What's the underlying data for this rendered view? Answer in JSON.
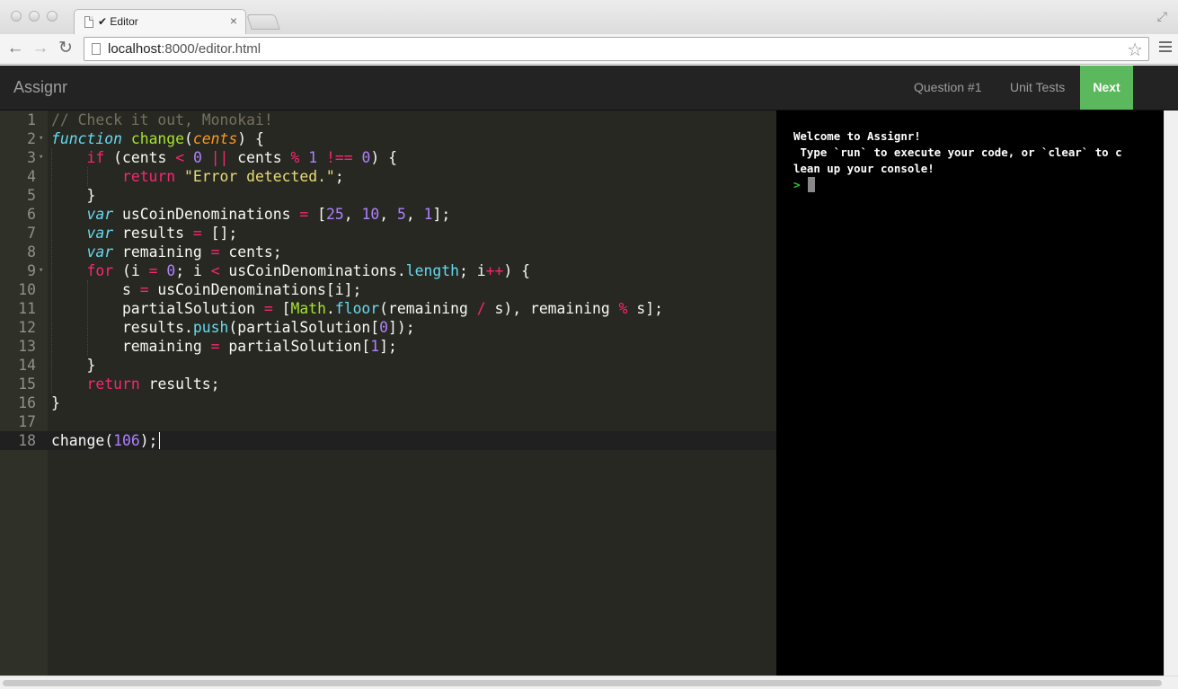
{
  "browser": {
    "tab_title": "✔ Editor",
    "tab_close": "×",
    "url_host": "localhost",
    "url_path": ":8000/editor.html",
    "back_glyph": "←",
    "forward_glyph": "→",
    "reload_glyph": "↻",
    "star_glyph": "☆",
    "fullscreen_glyph": "⤢"
  },
  "app": {
    "brand": "Assignr",
    "nav": {
      "question": "Question #1",
      "unit_tests": "Unit Tests",
      "next": "Next"
    },
    "colors": {
      "nav_bg": "#232323",
      "next_bg": "#5cb85c",
      "editor_bg": "#272822",
      "console_bg": "#000000"
    }
  },
  "editor": {
    "theme": "Monokai",
    "active_line": 18,
    "lines": [
      {
        "n": "1",
        "fold": false,
        "tokens": [
          {
            "t": "// Check it out, Monokai!",
            "c": "c-com"
          }
        ]
      },
      {
        "n": "2",
        "fold": true,
        "tokens": [
          {
            "t": "function",
            "c": "c-st"
          },
          {
            "t": " ",
            "c": ""
          },
          {
            "t": "change",
            "c": "c-fn"
          },
          {
            "t": "(",
            "c": ""
          },
          {
            "t": "cents",
            "c": "c-par"
          },
          {
            "t": ") {",
            "c": ""
          }
        ]
      },
      {
        "n": "3",
        "fold": true,
        "tokens": [
          {
            "t": "    ",
            "c": ""
          },
          {
            "t": "if",
            "c": "c-kw"
          },
          {
            "t": " (cents ",
            "c": ""
          },
          {
            "t": "<",
            "c": "c-kw"
          },
          {
            "t": " ",
            "c": ""
          },
          {
            "t": "0",
            "c": "c-num"
          },
          {
            "t": " ",
            "c": ""
          },
          {
            "t": "||",
            "c": "c-kw"
          },
          {
            "t": " cents ",
            "c": ""
          },
          {
            "t": "%",
            "c": "c-kw"
          },
          {
            "t": " ",
            "c": ""
          },
          {
            "t": "1",
            "c": "c-num"
          },
          {
            "t": " ",
            "c": ""
          },
          {
            "t": "!==",
            "c": "c-kw"
          },
          {
            "t": " ",
            "c": ""
          },
          {
            "t": "0",
            "c": "c-num"
          },
          {
            "t": ") {",
            "c": ""
          }
        ]
      },
      {
        "n": "4",
        "fold": false,
        "tokens": [
          {
            "t": "        ",
            "c": ""
          },
          {
            "t": "return",
            "c": "c-kw"
          },
          {
            "t": " ",
            "c": ""
          },
          {
            "t": "\"Error detected.\"",
            "c": "c-str"
          },
          {
            "t": ";",
            "c": ""
          }
        ]
      },
      {
        "n": "5",
        "fold": false,
        "tokens": [
          {
            "t": "    }",
            "c": ""
          }
        ]
      },
      {
        "n": "6",
        "fold": false,
        "tokens": [
          {
            "t": "    ",
            "c": ""
          },
          {
            "t": "var",
            "c": "c-st"
          },
          {
            "t": " usCoinDenominations ",
            "c": ""
          },
          {
            "t": "=",
            "c": "c-kw"
          },
          {
            "t": " [",
            "c": ""
          },
          {
            "t": "25",
            "c": "c-num"
          },
          {
            "t": ", ",
            "c": ""
          },
          {
            "t": "10",
            "c": "c-num"
          },
          {
            "t": ", ",
            "c": ""
          },
          {
            "t": "5",
            "c": "c-num"
          },
          {
            "t": ", ",
            "c": ""
          },
          {
            "t": "1",
            "c": "c-num"
          },
          {
            "t": "];",
            "c": ""
          }
        ]
      },
      {
        "n": "7",
        "fold": false,
        "tokens": [
          {
            "t": "    ",
            "c": ""
          },
          {
            "t": "var",
            "c": "c-st"
          },
          {
            "t": " results ",
            "c": ""
          },
          {
            "t": "=",
            "c": "c-kw"
          },
          {
            "t": " [];",
            "c": ""
          }
        ]
      },
      {
        "n": "8",
        "fold": false,
        "tokens": [
          {
            "t": "    ",
            "c": ""
          },
          {
            "t": "var",
            "c": "c-st"
          },
          {
            "t": " remaining ",
            "c": ""
          },
          {
            "t": "=",
            "c": "c-kw"
          },
          {
            "t": " cents;",
            "c": ""
          }
        ]
      },
      {
        "n": "9",
        "fold": true,
        "tokens": [
          {
            "t": "    ",
            "c": ""
          },
          {
            "t": "for",
            "c": "c-kw"
          },
          {
            "t": " (i ",
            "c": ""
          },
          {
            "t": "=",
            "c": "c-kw"
          },
          {
            "t": " ",
            "c": ""
          },
          {
            "t": "0",
            "c": "c-num"
          },
          {
            "t": "; i ",
            "c": ""
          },
          {
            "t": "<",
            "c": "c-kw"
          },
          {
            "t": " usCoinDenominations.",
            "c": ""
          },
          {
            "t": "length",
            "c": "c-sup"
          },
          {
            "t": "; i",
            "c": ""
          },
          {
            "t": "++",
            "c": "c-kw"
          },
          {
            "t": ") {",
            "c": ""
          }
        ]
      },
      {
        "n": "10",
        "fold": false,
        "tokens": [
          {
            "t": "        s ",
            "c": ""
          },
          {
            "t": "=",
            "c": "c-kw"
          },
          {
            "t": " usCoinDenominations[i];",
            "c": ""
          }
        ]
      },
      {
        "n": "11",
        "fold": false,
        "tokens": [
          {
            "t": "        partialSolution ",
            "c": ""
          },
          {
            "t": "=",
            "c": "c-kw"
          },
          {
            "t": " [",
            "c": ""
          },
          {
            "t": "Math",
            "c": "c-lib"
          },
          {
            "t": ".",
            "c": ""
          },
          {
            "t": "floor",
            "c": "c-sup"
          },
          {
            "t": "(remaining ",
            "c": ""
          },
          {
            "t": "/",
            "c": "c-kw"
          },
          {
            "t": " s), remaining ",
            "c": ""
          },
          {
            "t": "%",
            "c": "c-kw"
          },
          {
            "t": " s];",
            "c": ""
          }
        ]
      },
      {
        "n": "12",
        "fold": false,
        "tokens": [
          {
            "t": "        results.",
            "c": ""
          },
          {
            "t": "push",
            "c": "c-sup"
          },
          {
            "t": "(partialSolution[",
            "c": ""
          },
          {
            "t": "0",
            "c": "c-num"
          },
          {
            "t": "]);",
            "c": ""
          }
        ]
      },
      {
        "n": "13",
        "fold": false,
        "tokens": [
          {
            "t": "        remaining ",
            "c": ""
          },
          {
            "t": "=",
            "c": "c-kw"
          },
          {
            "t": " partialSolution[",
            "c": ""
          },
          {
            "t": "1",
            "c": "c-num"
          },
          {
            "t": "];",
            "c": ""
          }
        ]
      },
      {
        "n": "14",
        "fold": false,
        "tokens": [
          {
            "t": "    }",
            "c": ""
          }
        ]
      },
      {
        "n": "15",
        "fold": false,
        "tokens": [
          {
            "t": "    ",
            "c": ""
          },
          {
            "t": "return",
            "c": "c-kw"
          },
          {
            "t": " results;",
            "c": ""
          }
        ]
      },
      {
        "n": "16",
        "fold": false,
        "tokens": [
          {
            "t": "}",
            "c": ""
          }
        ]
      },
      {
        "n": "17",
        "fold": false,
        "tokens": []
      },
      {
        "n": "18",
        "fold": false,
        "tokens": [
          {
            "t": "change(",
            "c": ""
          },
          {
            "t": "106",
            "c": "c-num"
          },
          {
            "t": ");",
            "c": ""
          }
        ]
      }
    ]
  },
  "console": {
    "lines": [
      "Welcome to Assignr!",
      " Type `run` to execute your code, or `clear` to c",
      "lean up your console!"
    ],
    "prompt": ">"
  }
}
